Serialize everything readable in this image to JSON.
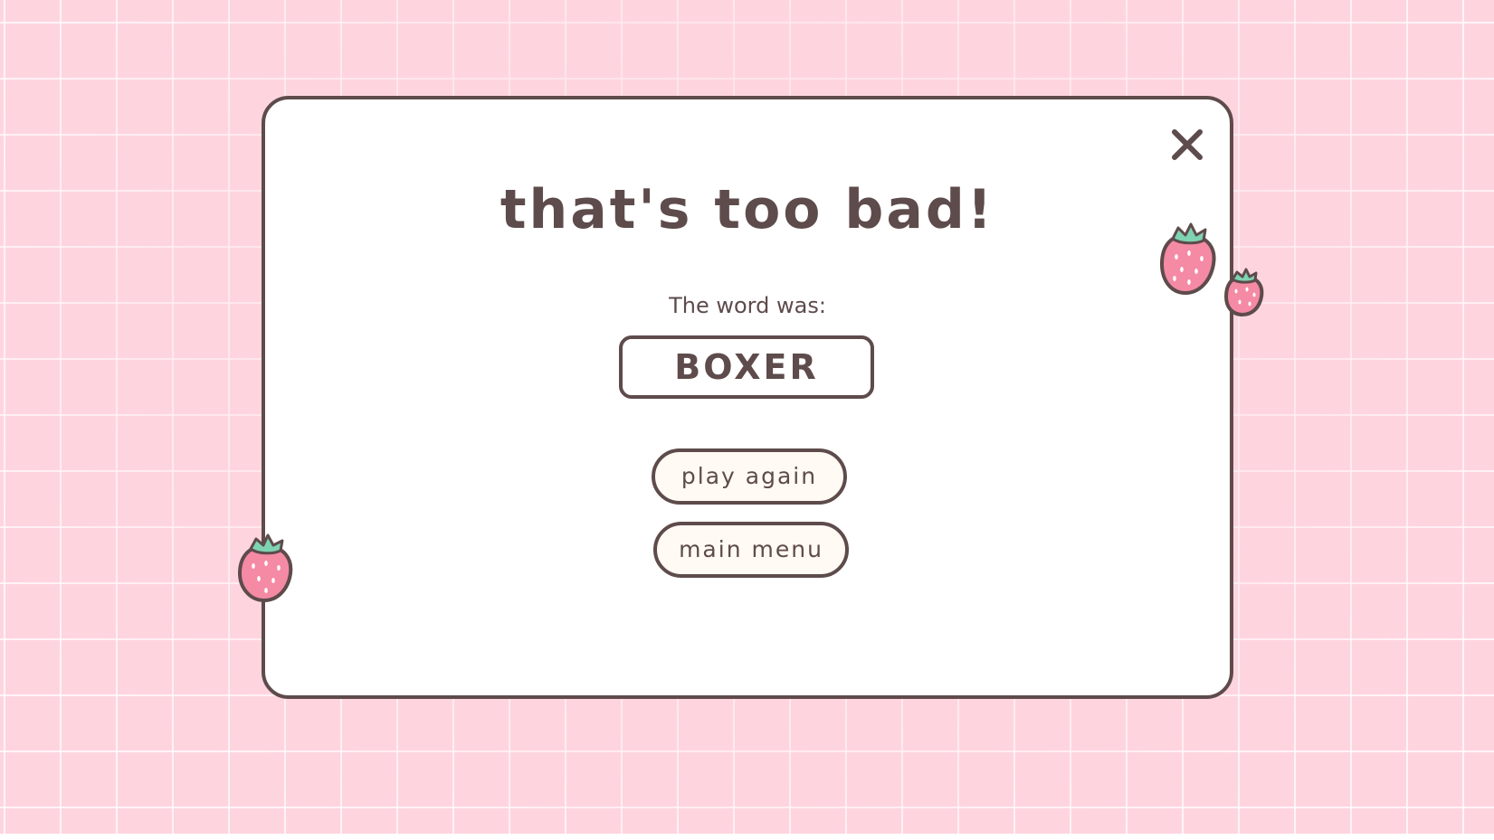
{
  "dialog": {
    "title": "that's too bad!",
    "word_label": "The word was:",
    "word": "BOXER",
    "close_icon": "close-icon"
  },
  "buttons": {
    "play_again": "play again",
    "main_menu": "main menu"
  },
  "decorations": [
    "strawberry-icon",
    "strawberry-icon",
    "strawberry-icon"
  ],
  "colors": {
    "background": "#fed5df",
    "grid": "#ffffff",
    "panel": "#ffffff",
    "outline": "#5e4b4b",
    "button_fill": "#fffaf3",
    "strawberry": "#f58aa5",
    "leaf": "#7ed3b2"
  }
}
